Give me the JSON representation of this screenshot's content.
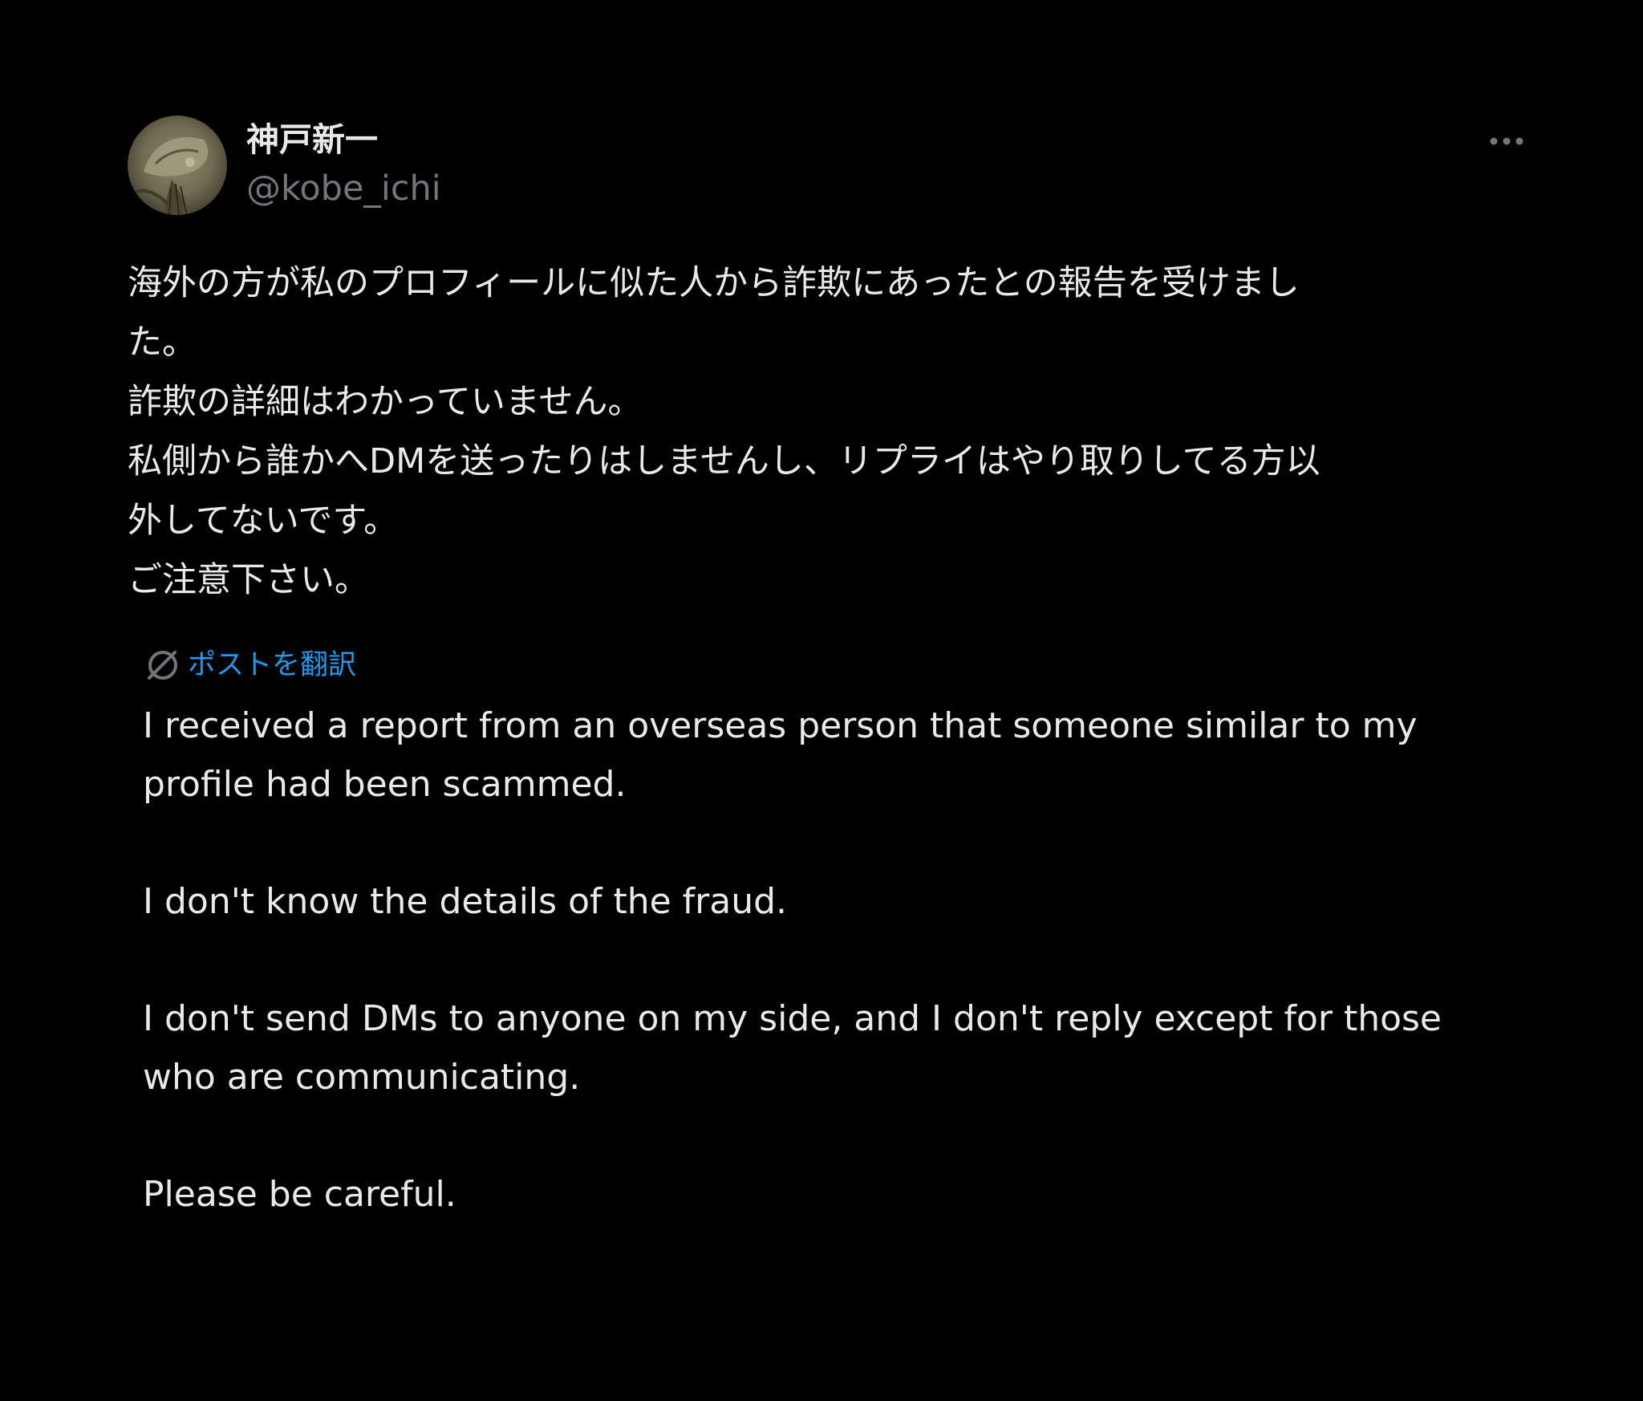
{
  "author": {
    "display_name": "神戸新一",
    "handle": "@kobe_ichi"
  },
  "post": {
    "original_lines": [
      "海外の方が私のプロフィールに似た人から詐欺にあったとの報告を受けまし",
      "た。",
      "詐欺の詳細はわかっていません。",
      "私側から誰かへDMを送ったりはしませんし、リプライはやり取りしてる方以",
      "外してないです。",
      "ご注意下さい。"
    ],
    "translate_label": "ポストを翻訳",
    "translation": {
      "p1_line1": "I received a report from an overseas person that someone similar to my",
      "p1_line2": "profile had been scammed.",
      "p2_line1": "I don't know the details of the fraud.",
      "p3_line1": "I don't send DMs to anyone on my side, and I don't reply except for those",
      "p3_line2": "who are communicating.",
      "p4_line1": "Please be careful."
    }
  },
  "icons": {
    "avatar": "avatar-image",
    "more": "more-options-icon",
    "translate": "translate-globe-icon"
  },
  "colors": {
    "background": "#000000",
    "text": "#e7e9ea",
    "secondary": "#71767b",
    "link": "#1d9bf0"
  }
}
